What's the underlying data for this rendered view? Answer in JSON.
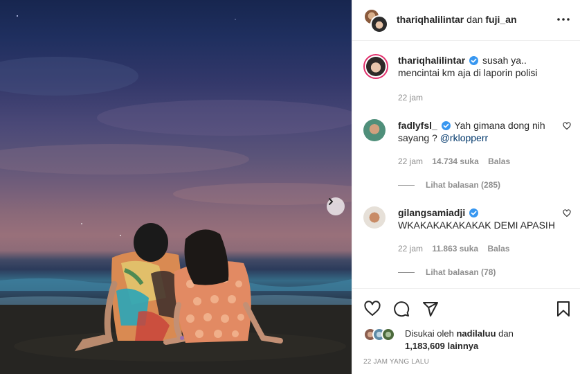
{
  "header": {
    "username_primary": "thariqhalilintar",
    "joiner": "dan",
    "username_secondary": "fuji_an"
  },
  "caption": {
    "username": "thariqhalilintar",
    "text": "susah ya.. mencintai km aja di laporin polisi",
    "time": "22 jam"
  },
  "comments": [
    {
      "username": "fadlyfsl_",
      "text": "Yah gimana dong nih sayang ?",
      "mention": "@rklopperr",
      "time": "22 jam",
      "likes": "14.734 suka",
      "reply_label": "Balas",
      "view_replies": "Lihat balasan (285)"
    },
    {
      "username": "gilangsamiadji",
      "text": "WKAKAKAKAKAKAK DEMI APASIH",
      "time": "22 jam",
      "likes": "11.863 suka",
      "reply_label": "Balas",
      "view_replies": "Lihat balasan (78)"
    }
  ],
  "likes": {
    "prefix": "Disukai oleh",
    "liker": "nadilaluu",
    "connector": "dan",
    "count": "1,183,609",
    "suffix": "lainnya"
  },
  "post_time": "22 JAM YANG LALU",
  "icons": {
    "more": "more-horizontal-icon",
    "like": "heart-icon",
    "comment": "comment-icon",
    "share": "share-icon",
    "save": "bookmark-icon",
    "next": "chevron-right-icon",
    "verified": "verified-badge-icon"
  },
  "colors": {
    "verified": "#3897f0",
    "mention": "#00376b",
    "muted": "#8e8e8e",
    "border": "#efefef"
  }
}
